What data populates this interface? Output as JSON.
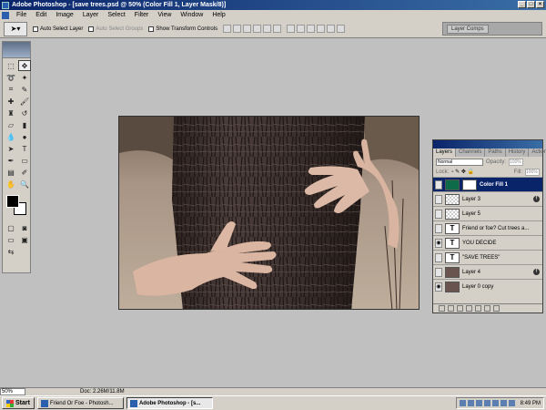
{
  "window": {
    "title": "Adobe Photoshop - [save trees.psd @ 50% (Color Fill 1, Layer Mask/8)]"
  },
  "menu": [
    "File",
    "Edit",
    "Image",
    "Layer",
    "Select",
    "Filter",
    "View",
    "Window",
    "Help"
  ],
  "options": {
    "auto_select_layer": "Auto Select Layer",
    "auto_select_groups": "Auto Select Groups",
    "show_transform_controls": "Show Transform Controls",
    "palette_well_tab": "Layer Comps"
  },
  "layers_panel": {
    "tabs": [
      "Layers",
      "Channels",
      "Paths",
      "History",
      "Actions"
    ],
    "blend_mode": "Normal",
    "opacity_label": "Opacity:",
    "opacity_value": "100%",
    "lock_label": "Lock:",
    "fill_label": "Fill:",
    "fill_value": "100%",
    "layers": [
      {
        "name": "Color Fill 1",
        "type": "fill",
        "selected": true,
        "visible": false
      },
      {
        "name": "Layer 3",
        "type": "pixel",
        "selected": false,
        "visible": false,
        "fx": true
      },
      {
        "name": "Layer 5",
        "type": "pixel",
        "selected": false,
        "visible": false
      },
      {
        "name": "Friend or foe? Cut trees a...",
        "type": "text",
        "selected": false,
        "visible": false
      },
      {
        "name": "YOU DECIDE",
        "type": "text",
        "selected": false,
        "visible": true
      },
      {
        "name": "\"SAVE TREES\"",
        "type": "text",
        "selected": false,
        "visible": false
      },
      {
        "name": "Layer 4",
        "type": "photo",
        "selected": false,
        "visible": false,
        "fx": true
      },
      {
        "name": "Layer 0 copy",
        "type": "photo",
        "selected": false,
        "visible": true
      }
    ]
  },
  "status": {
    "zoom": "50%",
    "doc_size": "Doc: 2.26M/11.8M"
  },
  "taskbar": {
    "start": "Start",
    "tasks": [
      "Friend Or Foe - Photosh...",
      "Adobe Photoshop - [s..."
    ],
    "clock": "8:49 PM"
  },
  "colors": {
    "title_bar": "#0a246a",
    "selected_layer": "#0a246a",
    "fill_swatch": "#0e6b4a",
    "canvas_bg": "#c0c0c0"
  }
}
